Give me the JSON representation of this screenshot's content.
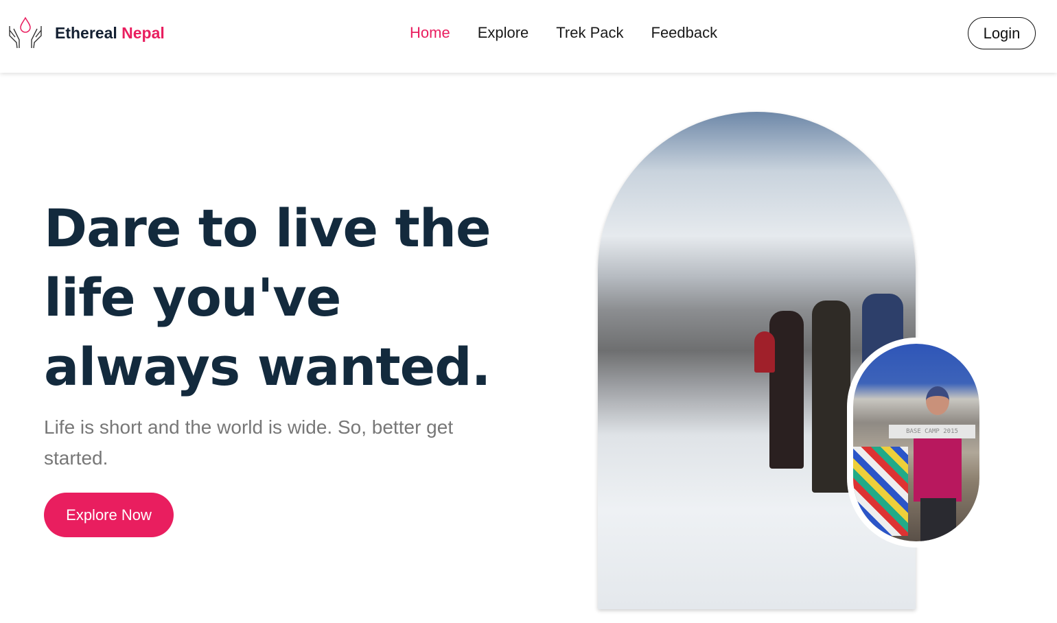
{
  "brand": {
    "name_part1": "Ethereal",
    "name_part2": "Nepal",
    "logo_icon": "hands-water-drop-icon"
  },
  "nav": {
    "links": [
      "Home",
      "Explore",
      "Trek Pack",
      "Feedback"
    ],
    "active": "Home",
    "login_label": "Login"
  },
  "hero": {
    "heading": "Dare to live the life you've always wanted.",
    "subtitle": "Life is short and the world is wide. So, better get started.",
    "cta_label": "Explore Now",
    "photo_sign": "BASE CAMP 2015"
  },
  "colors": {
    "accent": "#e91e5f",
    "heading": "#132a3d",
    "subtitle": "#777777"
  }
}
